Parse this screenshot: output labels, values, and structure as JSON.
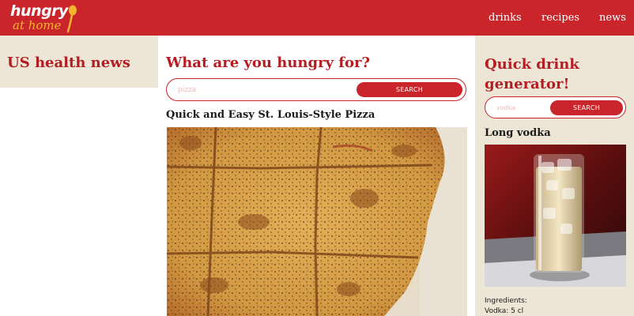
{
  "header": {
    "logo_top": "hungry",
    "logo_bottom": "at home",
    "nav": [
      "drinks",
      "recipes",
      "news"
    ]
  },
  "left": {
    "title": "US health news"
  },
  "main": {
    "title": "What are you hungry for?",
    "search": {
      "placeholder": "pizza",
      "button": "SEARCH"
    },
    "recipe_title": "Quick and Easy St. Louis-Style Pizza"
  },
  "right": {
    "title": "Quick drink generator!",
    "search": {
      "placeholder": "vodka",
      "button": "SEARCH"
    },
    "drink_name": "Long vodka",
    "ingredients_label": "Ingredients:",
    "ingredients": [
      "Vodka: 5 cl"
    ]
  },
  "colors": {
    "brand_red": "#c9252a",
    "accent_yellow": "#f1b52e",
    "sidebar_bg": "#ede5d6"
  }
}
